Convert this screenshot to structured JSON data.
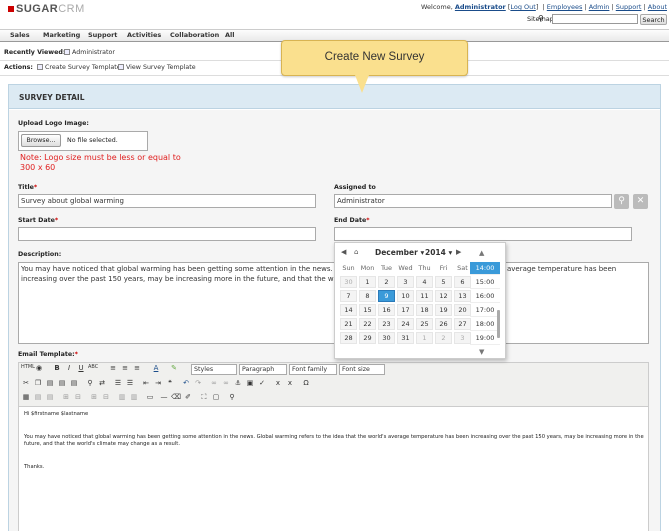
{
  "header": {
    "logo_main": "SUGAR",
    "logo_sub": "CRM",
    "welcome": "Welcome,",
    "user": "Administrator",
    "logout": "Log Out",
    "links": [
      "Employees",
      "Admin",
      "Support",
      "About"
    ],
    "sitemap": "Sitemap",
    "search_button": "Search"
  },
  "nav": {
    "tabs": [
      "Sales",
      "Marketing",
      "Support",
      "Activities",
      "Collaboration",
      "All"
    ]
  },
  "recently_viewed": {
    "label": "Recently Viewed:",
    "item": "Administrator"
  },
  "actions": {
    "label": "Actions:",
    "items": [
      "Create Survey Template",
      "View Survey Template"
    ]
  },
  "tooltip": "Create New Survey",
  "panel": {
    "title": "SURVEY DETAIL"
  },
  "form": {
    "logo_label": "Upload Logo Image:",
    "browse": "Browse...",
    "no_file": "No file selected.",
    "note_line1": "Note: Logo size must be less or equal to",
    "note_line2": "300 x 60",
    "title_label": "Title",
    "title_value": "Survey about global warming",
    "assigned_label": "Assigned to",
    "assigned_value": "Administrator",
    "start_label": "Start Date",
    "end_label": "End Date",
    "description_label": "Description:",
    "description_line1_left": "You may have noticed that global warming has been getting some attention in the news. G",
    "description_line1_right": "average temperature has been",
    "description_line2": "increasing over the past 150 years, may be increasing more in the future, and that the wo",
    "email_label": "Email Template:",
    "req": "*"
  },
  "editor": {
    "styles": "Styles",
    "paragraph": "Paragraph",
    "font_family": "Font family",
    "font_size": "Font size",
    "greeting": "Hi $firstname $lastname",
    "body_line1": "You may have noticed that global warming has been getting some attention in the news. Global warming refers to the idea that the world's average temperature has been increasing over the past 150 years, may be increasing more in the",
    "body_line2": "future, and that the world's climate may change as a result.",
    "closing": "Thanks."
  },
  "datepicker": {
    "month": "December",
    "year": "2014",
    "weekdays": [
      "Sun",
      "Mon",
      "Tue",
      "Wed",
      "Thu",
      "Fri",
      "Sat"
    ],
    "weeks": [
      [
        "30",
        "1",
        "2",
        "3",
        "4",
        "5",
        "6"
      ],
      [
        "7",
        "8",
        "9",
        "10",
        "11",
        "12",
        "13"
      ],
      [
        "14",
        "15",
        "16",
        "17",
        "18",
        "19",
        "20"
      ],
      [
        "21",
        "22",
        "23",
        "24",
        "25",
        "26",
        "27"
      ],
      [
        "28",
        "29",
        "30",
        "31",
        "1",
        "2",
        "3"
      ]
    ],
    "selected_day": "9",
    "times": [
      "14:00",
      "15:00",
      "16:00",
      "17:00",
      "18:00",
      "19:00"
    ],
    "selected_time": "14:00",
    "accent": "#3a9ad9"
  }
}
